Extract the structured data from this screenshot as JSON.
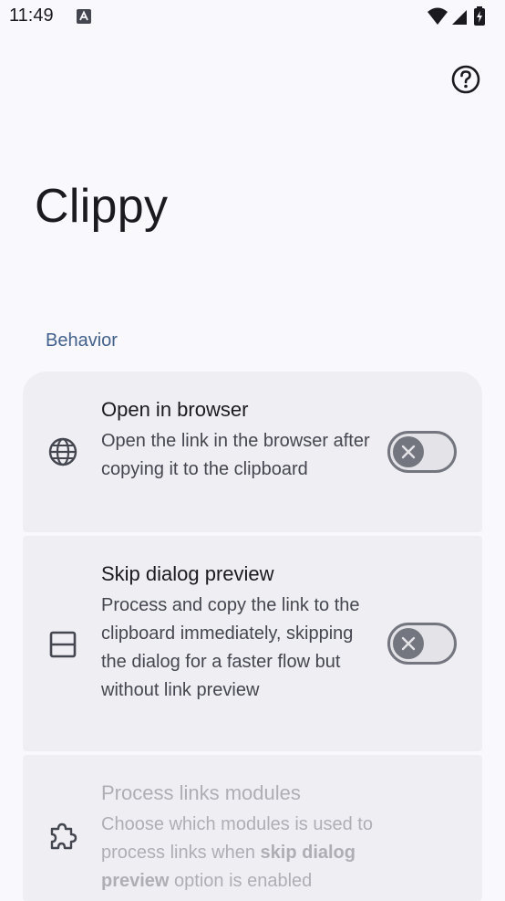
{
  "status_bar": {
    "time": "11:49"
  },
  "header": {
    "help_icon": "help-circle-icon"
  },
  "page": {
    "title": "Clippy"
  },
  "section": {
    "label": "Behavior"
  },
  "settings": [
    {
      "title": "Open in browser",
      "description": "Open the link in the browser after copying it to the clipboard",
      "icon": "globe-icon",
      "toggle_on": false
    },
    {
      "title": "Skip dialog preview",
      "description": "Process and copy the link to the clipboard immediately, skipping the dialog for a faster flow but without link preview",
      "icon": "panel-icon",
      "toggle_on": false
    },
    {
      "title": "Process links modules",
      "description_parts": [
        "Choose which modules is used to process links when ",
        "skip dialog preview",
        " option is enabled"
      ],
      "icon": "puzzle-icon",
      "enabled": false
    }
  ],
  "colors": {
    "accent": "#43618d",
    "card": "#eeeef3",
    "background": "#f9f8fd",
    "toggle_outline": "#74767f"
  }
}
